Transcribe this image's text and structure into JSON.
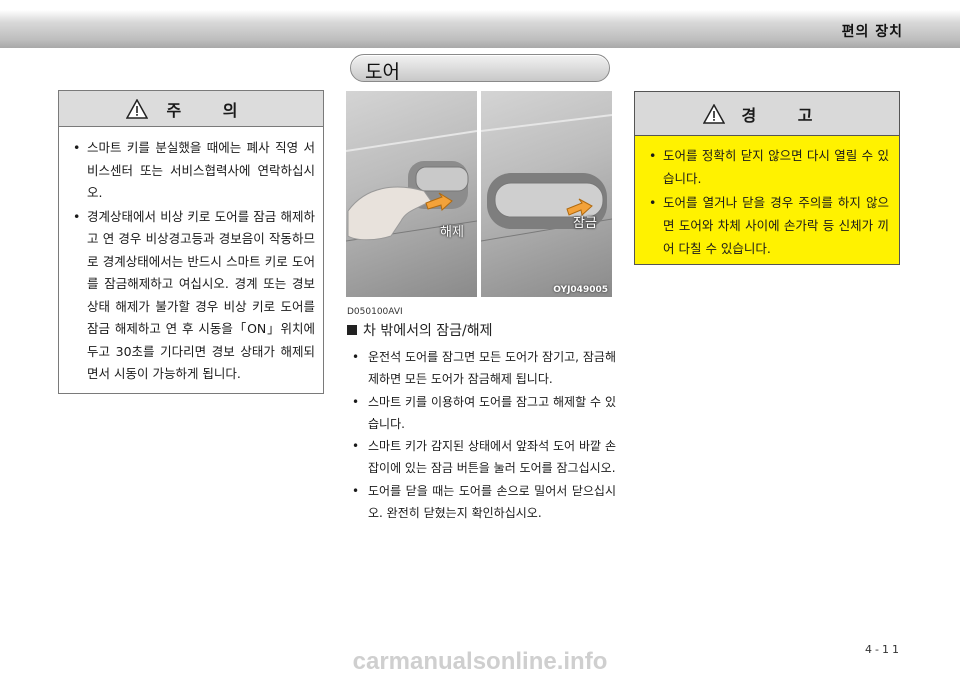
{
  "header": {
    "title": "편의 장치"
  },
  "section": {
    "title": "도어"
  },
  "caution": {
    "title": "주 의",
    "items": [
      "스마트 키를 분실했을 때에는 폐사 직영 서비스센터 또는 서비스협력사에 연락하십시오.",
      "경계상태에서 비상 키로 도어를 잠금 해제하고 연 경우 비상경고등과 경보음이 작동하므로 경계상태에서는 반드시 스마트 키로 도어를 잠금해제하고 여십시오. 경계 또는 경보 상태 해제가 불가할 경우 비상 키로 도어를 잠금 해제하고 연 후 시동을「ON」위치에 두고 30초를 기다리면 경보 상태가 해제되면서 시동이 가능하게 됩니다."
    ]
  },
  "photos": {
    "left_label": "해제",
    "right_label": "잠금",
    "code": "OYJ049005"
  },
  "ref_code": "D050100AVI",
  "subheading": "차 밖에서의 잠금/해제",
  "main_items": [
    "운전석 도어를 잠그면 모든 도어가 잠기고, 잠금해제하면 모든 도어가 잠금해제 됩니다.",
    "스마트 키를 이용하여 도어를 잠그고 해제할 수 있습니다.",
    "스마트 키가 감지된 상태에서 앞좌석 도어 바깥 손잡이에 있는 잠금 버튼을 눌러 도어를 잠그십시오.",
    "도어를 닫을 때는 도어를 손으로 밀어서 닫으십시오. 완전히 닫혔는지 확인하십시오."
  ],
  "warning": {
    "title": "경 고",
    "items": [
      "도어를 정확히 닫지 않으면 다시 열릴 수 있습니다.",
      "도어를 열거나 닫을 경우 주의를 하지 않으면 도어와 차체 사이에 손가락 등 신체가 끼어 다칠 수 있습니다."
    ]
  },
  "page_number": "4-11",
  "watermark": "carmanualsonline.info",
  "colors": {
    "warning_bg": "#fff200",
    "head_gray": "#dcdcdc"
  }
}
